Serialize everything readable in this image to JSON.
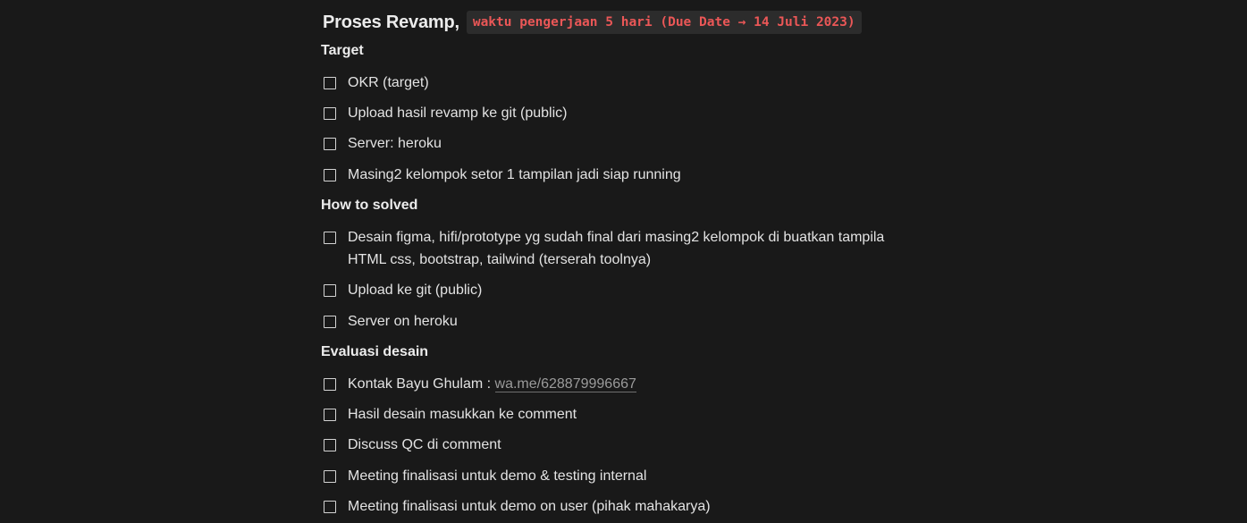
{
  "title": {
    "main": "Proses Revamp,",
    "code": "waktu pengerjaan 5 hari (Due Date → 14 Juli 2023)"
  },
  "sections": {
    "target": {
      "heading": "Target",
      "items": [
        {
          "text": "OKR (target)",
          "checked": false
        },
        {
          "text": "Upload hasil revamp ke git (public)",
          "checked": false
        },
        {
          "text": "Server: heroku",
          "checked": false
        },
        {
          "text": "Masing2 kelompok setor 1 tampilan jadi siap running",
          "checked": false
        }
      ]
    },
    "how_to_solved": {
      "heading": "How to solved",
      "items": [
        {
          "line1": "Desain figma, hifi/prototype yg sudah final dari masing2 kelompok di buatkan tampila",
          "line2": "HTML css, bootstrap, tailwind (terserah toolnya)",
          "checked": false
        },
        {
          "text": "Upload ke git (public)",
          "checked": false
        },
        {
          "text": "Server on heroku",
          "checked": false
        }
      ]
    },
    "evaluasi": {
      "heading": "Evaluasi desain",
      "items": [
        {
          "prefix": "Kontak Bayu Ghulam : ",
          "link": "wa.me/628879996667",
          "checked": false
        },
        {
          "text": "Hasil desain masukkan ke comment",
          "checked": false
        },
        {
          "text": "Discuss QC di comment",
          "checked": false
        },
        {
          "text": "Meeting finalisasi untuk demo & testing internal",
          "checked": false
        },
        {
          "text": "Meeting finalisasi untuk demo on user (pihak mahakarya)",
          "checked": false
        }
      ]
    }
  },
  "colors": {
    "background": "#191919",
    "text": "#e3e3e3",
    "code_text": "#eb5757",
    "code_bg": "#2c2c2c",
    "link": "#9b9b9b"
  },
  "icons": {
    "checkbox": "checkbox-unchecked-icon"
  }
}
